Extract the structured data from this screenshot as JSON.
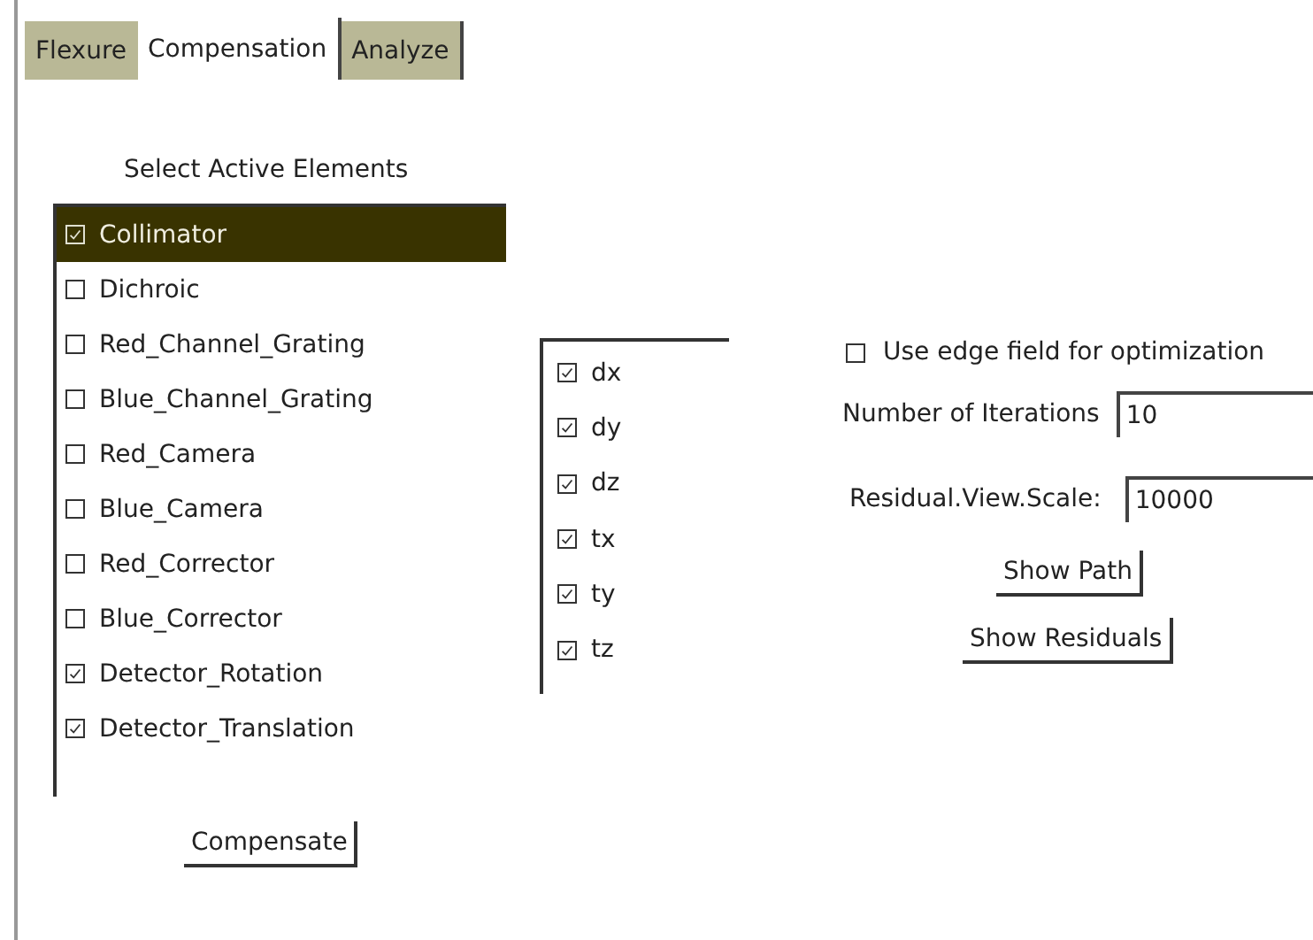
{
  "tabs": [
    {
      "label": "Flexure",
      "selected": false
    },
    {
      "label": "Compensation",
      "selected": true
    },
    {
      "label": "Analyze",
      "selected": false
    }
  ],
  "elements_title": "Select Active Elements",
  "elements": [
    {
      "label": "Collimator",
      "checked": true,
      "selected": true
    },
    {
      "label": "Dichroic",
      "checked": false,
      "selected": false
    },
    {
      "label": "Red_Channel_Grating",
      "checked": false,
      "selected": false
    },
    {
      "label": "Blue_Channel_Grating",
      "checked": false,
      "selected": false
    },
    {
      "label": "Red_Camera",
      "checked": false,
      "selected": false
    },
    {
      "label": "Blue_Camera",
      "checked": false,
      "selected": false
    },
    {
      "label": "Red_Corrector",
      "checked": false,
      "selected": false
    },
    {
      "label": "Blue_Corrector",
      "checked": false,
      "selected": false
    },
    {
      "label": "Detector_Rotation",
      "checked": true,
      "selected": false
    },
    {
      "label": "Detector_Translation",
      "checked": true,
      "selected": false
    }
  ],
  "compensate_button": "Compensate",
  "axes": [
    {
      "label": "dx",
      "checked": true
    },
    {
      "label": "dy",
      "checked": true
    },
    {
      "label": "dz",
      "checked": true
    },
    {
      "label": "tx",
      "checked": true
    },
    {
      "label": "ty",
      "checked": true
    },
    {
      "label": "tz",
      "checked": true
    }
  ],
  "edge_field": {
    "label": "Use edge field for optimization",
    "checked": false
  },
  "iterations": {
    "label": "Number of Iterations",
    "value": "10"
  },
  "view_scale": {
    "label": "Residual.View.Scale:",
    "value": "10000"
  },
  "show_path_button": "Show Path",
  "show_residuals_button": "Show Residuals"
}
